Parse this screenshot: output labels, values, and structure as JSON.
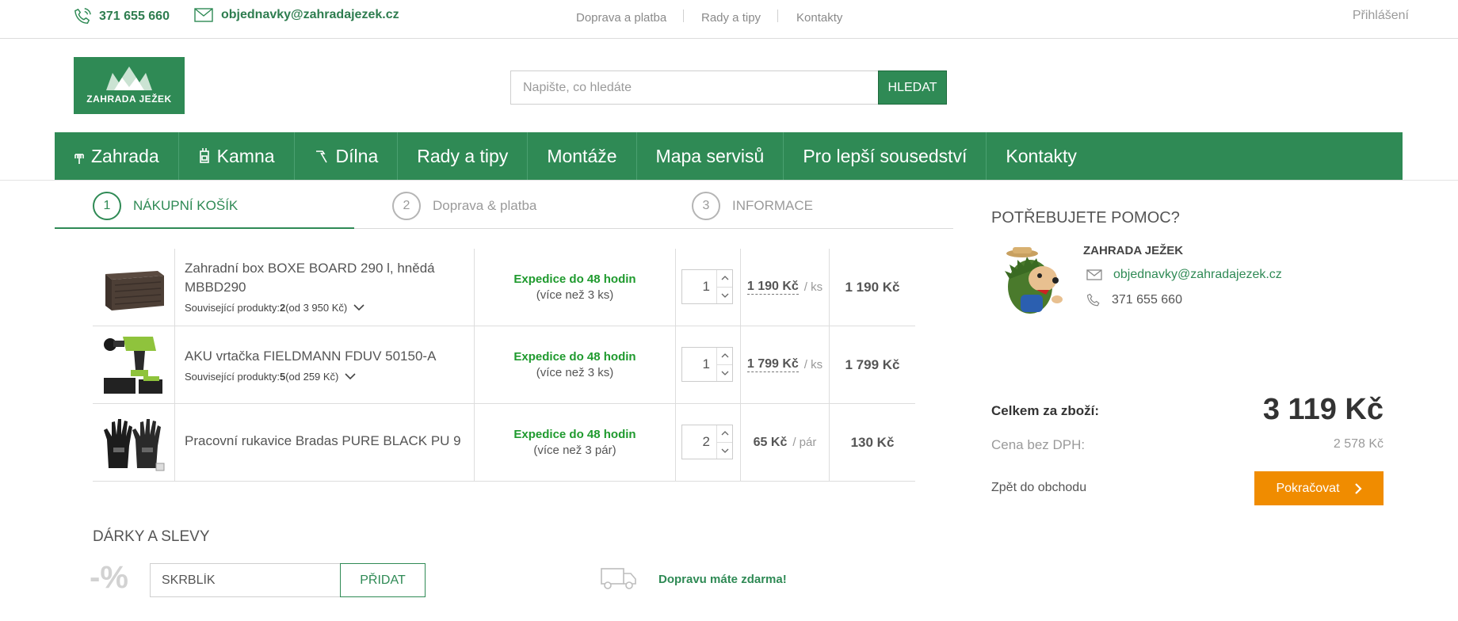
{
  "topbar": {
    "phone": "371 655 660",
    "email": "objednavky@zahradajezek.cz",
    "links": [
      "Doprava a platba",
      "Rady a tipy",
      "Kontakty"
    ],
    "login": "Přihlášení"
  },
  "logo": {
    "text": "ZAHRADA JEŽEK"
  },
  "search": {
    "placeholder": "Napište, co hledáte",
    "button": "HLEDAT"
  },
  "nav": {
    "items": [
      {
        "label": "Zahrada",
        "icon": "rake-icon"
      },
      {
        "label": "Kamna",
        "icon": "stove-icon"
      },
      {
        "label": "Dílna",
        "icon": "hammer-icon"
      },
      {
        "label": "Rady a tipy"
      },
      {
        "label": "Montáže"
      },
      {
        "label": "Mapa servisů"
      },
      {
        "label": "Pro lepší sousedství"
      },
      {
        "label": "Kontakty"
      }
    ]
  },
  "steps": [
    {
      "num": "1",
      "label": "NÁKUPNÍ KOŠÍK",
      "active": true
    },
    {
      "num": "2",
      "label": "Doprava & platba",
      "active": false
    },
    {
      "num": "3",
      "label": "INFORMACE",
      "active": false
    }
  ],
  "cart": {
    "items": [
      {
        "name": "Zahradní box BOXE BOARD 290 l, hnědá MBBD290",
        "related_prefix": "Související produkty: ",
        "related_count": "2",
        "related_from": " (od 3 950 Kč)",
        "expedition": "Expedice do 48 hodin",
        "availability": "(více než 3 ks)",
        "qty": "1",
        "unit_price": "1 190 Kč",
        "unit": "/ ks",
        "total": "1 190 Kč",
        "image": "storage-box-image"
      },
      {
        "name": "AKU vrtačka FIELDMANN FDUV 50150-A",
        "related_prefix": "Související produkty: ",
        "related_count": "5",
        "related_from": " (od 259 Kč)",
        "expedition": "Expedice do 48 hodin",
        "availability": "(více než 3 ks)",
        "qty": "1",
        "unit_price": "1 799 Kč",
        "unit": "/ ks",
        "total": "1 799 Kč",
        "image": "drill-image"
      },
      {
        "name": "Pracovní rukavice Bradas PURE BLACK PU 9",
        "expedition": "Expedice do 48 hodin",
        "availability": "(více než 3 pár)",
        "qty": "2",
        "unit_price": "65 Kč",
        "unit": "/ pár",
        "total": "130 Kč",
        "image": "gloves-image"
      }
    ]
  },
  "gifts": {
    "title": "DÁRKY A SLEVY",
    "percent": "-%",
    "coupon_value": "SKRBLÍK",
    "add_button": "PŘIDAT",
    "free_shipping": "Dopravu máte zdarma!"
  },
  "help": {
    "title": "POTŘEBUJETE POMOC?",
    "company": "ZAHRADA JEŽEK",
    "email": "objednavky@zahradajezek.cz",
    "phone": "371 655 660"
  },
  "summary": {
    "total_label": "Celkem za zboží:",
    "total_value": "3 119 Kč",
    "vat_label": "Cena bez DPH:",
    "vat_value": "2 578 Kč",
    "back_link": "Zpět do obchodu",
    "continue_button": "Pokračovat"
  },
  "colors": {
    "brand_green": "#2f8a55",
    "accent_orange": "#f08c00",
    "stock_green": "#1f9a2e"
  }
}
